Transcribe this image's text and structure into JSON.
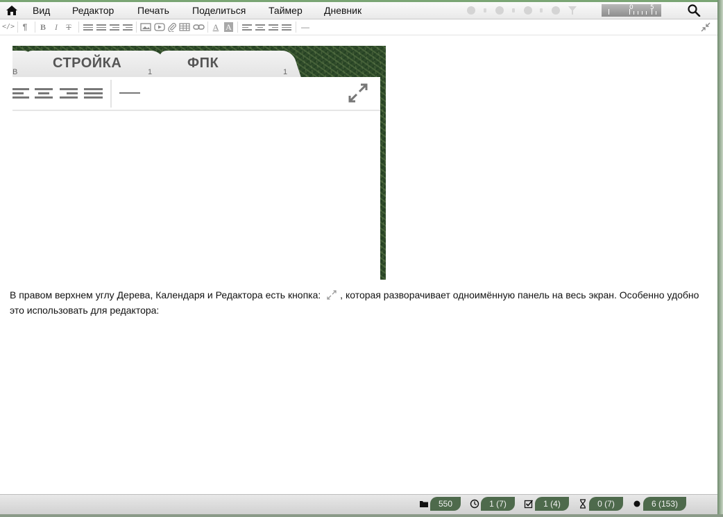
{
  "menubar": {
    "items": [
      "Вид",
      "Редактор",
      "Печать",
      "Поделиться",
      "Таймер",
      "Дневник"
    ],
    "ruler_labels": [
      "0",
      "5"
    ]
  },
  "toolbar": {
    "source_label": "</>",
    "paragraph_label": "¶",
    "bold_label": "B",
    "italic_label": "I",
    "strike_label": "T",
    "font_color_label": "A",
    "font_bg_label": "A",
    "hr_label": "—"
  },
  "screenshot": {
    "tab_left_fragment": "В",
    "tabs": [
      {
        "label": "СТРОЙКА",
        "count": "1"
      },
      {
        "label": "ФПК",
        "count": "1"
      }
    ]
  },
  "content": {
    "text_before": "В правом верхнем углу Дерева, Календаря и Редактора есть кнопка:",
    "text_after": ", которая разворачивает одноимённую панель на весь экран. Особенно удобно это использовать для редактора:"
  },
  "statusbar": {
    "notes": "550",
    "reminders": "1 (7)",
    "tasks": "1 (4)",
    "timers": "0 (7)",
    "records": "6 (153)"
  },
  "colors": {
    "accent_green": "#4e6a4c",
    "top_strip": "#7aa574"
  }
}
